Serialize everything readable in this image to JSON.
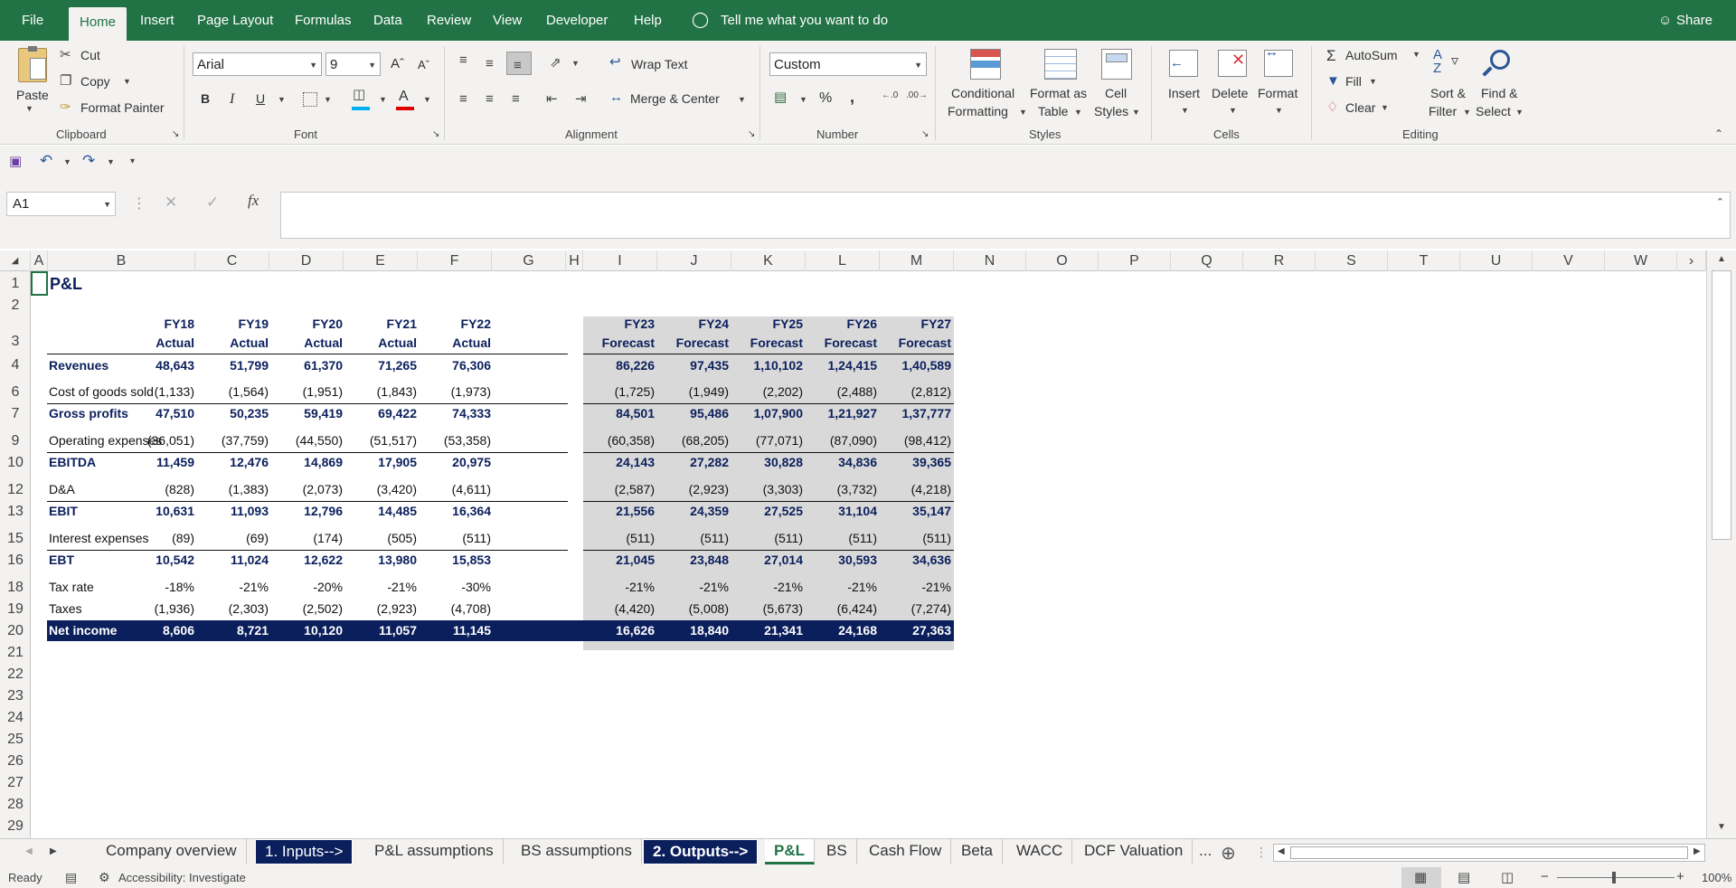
{
  "menu": {
    "file": "File",
    "home": "Home",
    "insert": "Insert",
    "page_layout": "Page Layout",
    "formulas": "Formulas",
    "data": "Data",
    "review": "Review",
    "view": "View",
    "developer": "Developer",
    "help": "Help",
    "tell_me": "Tell me what you want to do",
    "share": "Share"
  },
  "ribbon": {
    "clipboard": {
      "paste": "Paste",
      "cut": "Cut",
      "copy": "Copy",
      "format_painter": "Format Painter",
      "label": "Clipboard"
    },
    "font": {
      "name": "Arial",
      "size": "9",
      "bold": "B",
      "italic": "I",
      "underline": "U",
      "label": "Font"
    },
    "alignment": {
      "wrap_text": "Wrap Text",
      "merge_center": "Merge & Center",
      "label": "Alignment"
    },
    "number": {
      "format": "Custom",
      "percent": "%",
      "comma": ",",
      "label": "Number"
    },
    "styles": {
      "conditional1": "Conditional",
      "conditional2": "Formatting",
      "format_as1": "Format as",
      "format_as2": "Table",
      "cell_styles1": "Cell",
      "cell_styles2": "Styles",
      "label": "Styles"
    },
    "cells": {
      "insert": "Insert",
      "delete": "Delete",
      "format": "Format",
      "label": "Cells"
    },
    "editing": {
      "autosum": "AutoSum",
      "fill": "Fill",
      "clear": "Clear",
      "sort1": "Sort &",
      "sort2": "Filter",
      "find1": "Find &",
      "find2": "Select",
      "label": "Editing"
    }
  },
  "formula_bar": {
    "name_box": "A1",
    "fx": "fx",
    "value": ""
  },
  "columns": [
    "A",
    "B",
    "C",
    "D",
    "E",
    "F",
    "G",
    "H",
    "I",
    "J",
    "K",
    "L",
    "M",
    "N",
    "O",
    "P",
    "Q",
    "R",
    "S",
    "T",
    "U",
    "V",
    "W"
  ],
  "rows": [
    "1",
    "2",
    "3",
    "4",
    "6",
    "7",
    "9",
    "10",
    "12",
    "13",
    "15",
    "16",
    "18",
    "19",
    "20",
    "21",
    "22",
    "23",
    "24",
    "25",
    "26",
    "27",
    "28",
    "29"
  ],
  "sheet": {
    "title": "P&L",
    "years": [
      "FY18",
      "FY19",
      "FY20",
      "FY21",
      "FY22",
      "FY23",
      "FY24",
      "FY25",
      "FY26",
      "FY27"
    ],
    "types": [
      "Actual",
      "Actual",
      "Actual",
      "Actual",
      "Actual",
      "Forecast",
      "Forecast",
      "Forecast",
      "Forecast",
      "Forecast"
    ],
    "lines": [
      {
        "label": "Revenues",
        "values": [
          "48,643",
          "51,799",
          "61,370",
          "71,265",
          "76,306",
          "86,226",
          "97,435",
          "1,10,102",
          "1,24,415",
          "1,40,589"
        ]
      },
      {
        "label": "Cost of goods sold",
        "values": [
          "(1,133)",
          "(1,564)",
          "(1,951)",
          "(1,843)",
          "(1,973)",
          "(1,725)",
          "(1,949)",
          "(2,202)",
          "(2,488)",
          "(2,812)"
        ]
      },
      {
        "label": "Gross profits",
        "values": [
          "47,510",
          "50,235",
          "59,419",
          "69,422",
          "74,333",
          "84,501",
          "95,486",
          "1,07,900",
          "1,21,927",
          "1,37,777"
        ]
      },
      {
        "label": "Operating expenses",
        "values": [
          "(36,051)",
          "(37,759)",
          "(44,550)",
          "(51,517)",
          "(53,358)",
          "(60,358)",
          "(68,205)",
          "(77,071)",
          "(87,090)",
          "(98,412)"
        ]
      },
      {
        "label": "EBITDA",
        "values": [
          "11,459",
          "12,476",
          "14,869",
          "17,905",
          "20,975",
          "24,143",
          "27,282",
          "30,828",
          "34,836",
          "39,365"
        ]
      },
      {
        "label": "D&A",
        "values": [
          "(828)",
          "(1,383)",
          "(2,073)",
          "(3,420)",
          "(4,611)",
          "(2,587)",
          "(2,923)",
          "(3,303)",
          "(3,732)",
          "(4,218)"
        ]
      },
      {
        "label": "EBIT",
        "values": [
          "10,631",
          "11,093",
          "12,796",
          "14,485",
          "16,364",
          "21,556",
          "24,359",
          "27,525",
          "31,104",
          "35,147"
        ]
      },
      {
        "label": "Interest expenses",
        "values": [
          "(89)",
          "(69)",
          "(174)",
          "(505)",
          "(511)",
          "(511)",
          "(511)",
          "(511)",
          "(511)",
          "(511)"
        ]
      },
      {
        "label": "EBT",
        "values": [
          "10,542",
          "11,024",
          "12,622",
          "13,980",
          "15,853",
          "21,045",
          "23,848",
          "27,014",
          "30,593",
          "34,636"
        ]
      },
      {
        "label": "Tax rate",
        "values": [
          "-18%",
          "-21%",
          "-20%",
          "-21%",
          "-30%",
          "-21%",
          "-21%",
          "-21%",
          "-21%",
          "-21%"
        ]
      },
      {
        "label": "Taxes",
        "values": [
          "(1,936)",
          "(2,303)",
          "(2,502)",
          "(2,923)",
          "(4,708)",
          "(4,420)",
          "(5,008)",
          "(5,673)",
          "(6,424)",
          "(7,274)"
        ]
      },
      {
        "label": "Net income",
        "values": [
          "8,606",
          "8,721",
          "10,120",
          "11,057",
          "11,145",
          "16,626",
          "18,840",
          "21,341",
          "24,168",
          "27,363"
        ]
      }
    ]
  },
  "tabs": [
    "Company overview",
    "1. Inputs-->",
    "P&L assumptions",
    "BS assumptions",
    "2. Outputs-->",
    "P&L",
    "BS",
    "Cash Flow",
    "Beta",
    "WACC",
    "DCF Valuation",
    "..."
  ],
  "status": {
    "ready": "Ready",
    "accessibility": "Accessibility: Investigate",
    "zoom": "100%"
  },
  "colors": {
    "excel_green": "#217346",
    "navy": "#0b1f5c",
    "forecast_shade": "#d9d9d9"
  }
}
